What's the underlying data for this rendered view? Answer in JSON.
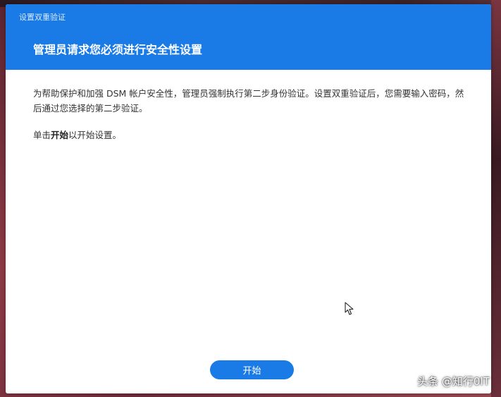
{
  "window": {
    "title": "设置双重验证"
  },
  "header": {
    "title": "管理员请求您必须进行安全性设置"
  },
  "content": {
    "paragraph1": "为帮助保护和加强 DSM 帐户安全性，管理员强制执行第二步身份验证。设置双重验证后，您需要输入密码，然后通过您选择的第二步验证。",
    "paragraph2_prefix": "单击",
    "paragraph2_bold": "开始",
    "paragraph2_suffix": "以开始设置。"
  },
  "footer": {
    "start_label": "开始"
  },
  "watermark": {
    "text": "头条 @知行0IT"
  },
  "colors": {
    "accent": "#1a7be6",
    "text": "#333333"
  }
}
